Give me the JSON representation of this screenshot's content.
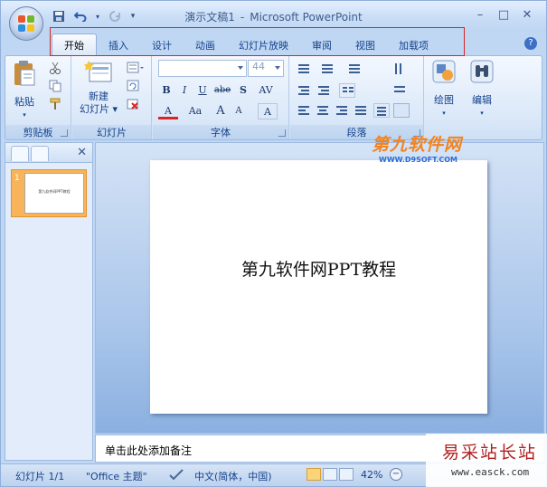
{
  "window": {
    "title_doc": "演示文稿1",
    "title_sep": "-",
    "title_app": "Microsoft PowerPoint",
    "minimize": "–",
    "maximize": "□",
    "close": "✕"
  },
  "qat": {
    "save_icon": "save-icon",
    "undo_icon": "undo-icon",
    "redo_icon": "redo-icon",
    "customize": "▾"
  },
  "tabs": [
    {
      "label": "开始",
      "active": true
    },
    {
      "label": "插入"
    },
    {
      "label": "设计"
    },
    {
      "label": "动画"
    },
    {
      "label": "幻灯片放映"
    },
    {
      "label": "审阅"
    },
    {
      "label": "视图"
    },
    {
      "label": "加载项"
    }
  ],
  "ribbon": {
    "clipboard": {
      "label": "剪贴板",
      "paste": "粘贴"
    },
    "slides": {
      "label": "幻灯片",
      "new_slide_line1": "新建",
      "new_slide_line2": "幻灯片"
    },
    "font": {
      "label": "字体",
      "font_name": "",
      "font_size": "44",
      "bold": "B",
      "italic": "I",
      "underline": "U",
      "strike": "abe",
      "shadow": "S",
      "spacing": "AV",
      "color": "A",
      "case": "Aa",
      "grow": "A",
      "shrink": "A",
      "clear": "A"
    },
    "paragraph": {
      "label": "段落"
    },
    "drawing": {
      "label": "绘图"
    },
    "editing": {
      "label": "编辑"
    }
  },
  "pane": {
    "slide_number": "1",
    "close": "✕"
  },
  "slide": {
    "title": "第九软件网PPT教程"
  },
  "notes": {
    "placeholder": "单击此处添加备注"
  },
  "status": {
    "slide_count": "幻灯片 1/1",
    "theme": "\"Office 主题\"",
    "language": "中文(简体，中国)",
    "zoom": "42%",
    "zoom_minus": "−"
  },
  "watermarks": {
    "top_cn": "第九软件网",
    "top_url": "WWW.D9SOFT.COM",
    "bottom_cn": "易采站长站",
    "bottom_url": "www.easck.com"
  },
  "colors": {
    "accent": "#15428b",
    "highlight_box": "#d52626",
    "watermark_orange": "#f2831f",
    "watermark_red": "#b02020"
  }
}
